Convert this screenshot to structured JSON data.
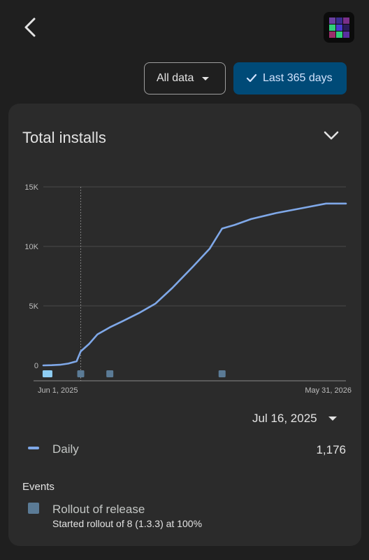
{
  "header": {
    "back_icon": "chevron-left-icon",
    "app_icon": "app-grid-icon"
  },
  "filters": {
    "all_data_label": "All data",
    "last_365_label": "Last 365 days",
    "last_365_selected": true
  },
  "card": {
    "title": "Total installs",
    "collapse_icon": "chevron-down-icon",
    "selected_date": "Jul 16, 2025",
    "legend": {
      "series_label": "Daily",
      "value": "1,176",
      "color": "#7fa8e8"
    },
    "events": {
      "heading": "Events",
      "items": [
        {
          "title": "Rollout of release",
          "description": "Started rollout of 8 (1.3.3) at 100%"
        }
      ]
    }
  },
  "chart_data": {
    "type": "line",
    "title": "",
    "xlabel": "",
    "ylabel": "",
    "ylim": [
      0,
      15000
    ],
    "y_ticks": [
      0,
      5000,
      10000,
      15000
    ],
    "y_tick_labels": [
      "0",
      "5K",
      "10K",
      "15K"
    ],
    "x_tick_labels": [
      "Jun 1, 2025",
      "May 31, 2026"
    ],
    "x_range": [
      "2025-06-01",
      "2026-05-31"
    ],
    "grid": true,
    "series": [
      {
        "name": "Daily",
        "color": "#7fa8e8",
        "points": [
          {
            "x": "2025-06-01",
            "y": 0
          },
          {
            "x": "2025-06-11",
            "y": 20
          },
          {
            "x": "2025-06-21",
            "y": 50
          },
          {
            "x": "2025-07-01",
            "y": 150
          },
          {
            "x": "2025-07-11",
            "y": 350
          },
          {
            "x": "2025-07-16",
            "y": 1176
          },
          {
            "x": "2025-07-26",
            "y": 1800
          },
          {
            "x": "2025-08-05",
            "y": 2600
          },
          {
            "x": "2025-08-20",
            "y": 3200
          },
          {
            "x": "2025-09-04",
            "y": 3700
          },
          {
            "x": "2025-09-24",
            "y": 4400
          },
          {
            "x": "2025-10-14",
            "y": 5200
          },
          {
            "x": "2025-11-03",
            "y": 6500
          },
          {
            "x": "2025-11-28",
            "y": 8300
          },
          {
            "x": "2025-12-18",
            "y": 9800
          },
          {
            "x": "2026-01-02",
            "y": 11500
          },
          {
            "x": "2026-01-17",
            "y": 11800
          },
          {
            "x": "2026-02-06",
            "y": 12300
          },
          {
            "x": "2026-03-08",
            "y": 12800
          },
          {
            "x": "2026-04-07",
            "y": 13200
          },
          {
            "x": "2026-05-07",
            "y": 13600
          },
          {
            "x": "2026-05-31",
            "y": 13600
          }
        ]
      }
    ],
    "event_markers": [
      {
        "x": "2025-06-06",
        "color": "#8ecdf2"
      },
      {
        "x": "2025-07-16",
        "color": "#5b7b96"
      },
      {
        "x": "2025-08-20",
        "color": "#5b7b96"
      },
      {
        "x": "2026-01-02",
        "color": "#5b7b96"
      }
    ],
    "selected_x": "2025-07-16"
  }
}
